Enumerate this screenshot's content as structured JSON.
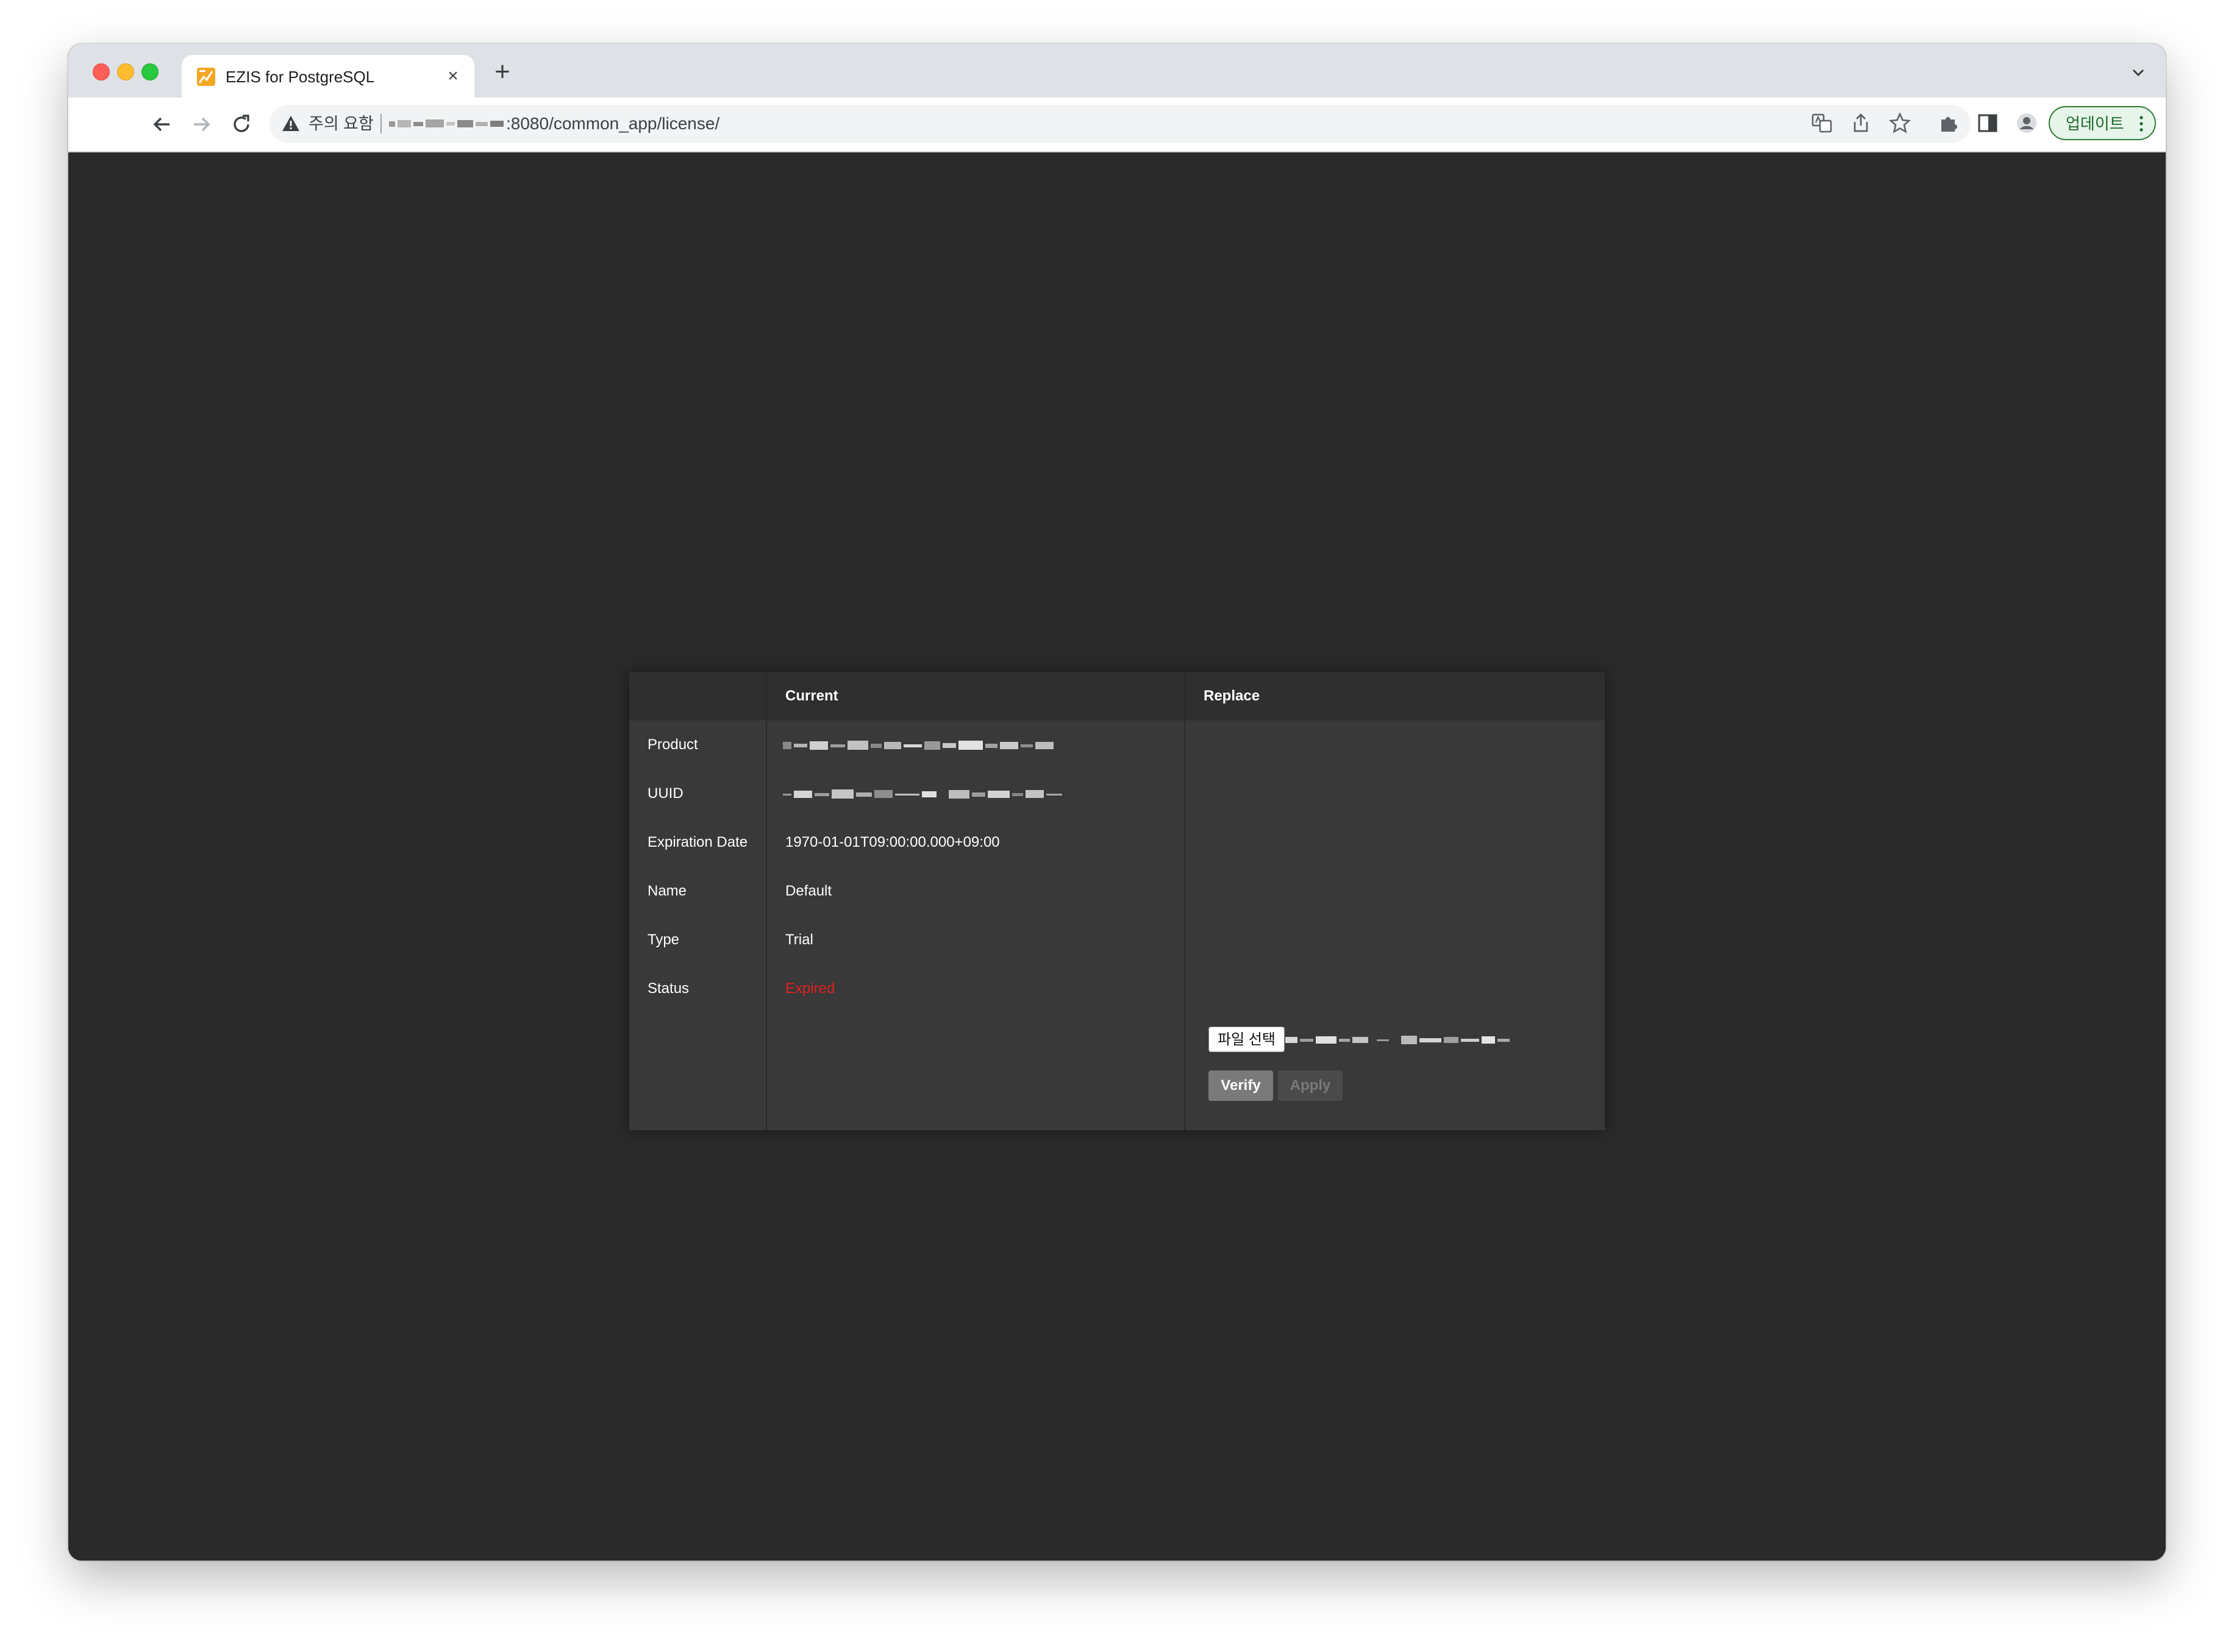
{
  "browser": {
    "tab": {
      "title": "EZIS for PostgreSQL",
      "close_glyph": "×",
      "favicon": "ezis-logo-icon"
    },
    "new_tab_glyph": "+",
    "address_bar": {
      "security_label": "주의 요함",
      "url_visible": ":8080/common_app/license/"
    },
    "update_button": {
      "label": "업데이트"
    }
  },
  "license": {
    "headers": {
      "current": "Current",
      "replace": "Replace"
    },
    "rows": [
      {
        "label": "Product",
        "value": null
      },
      {
        "label": "UUID",
        "value": null
      },
      {
        "label": "Expiration Date",
        "value": "1970-01-01T09:00:00.000+09:00"
      },
      {
        "label": "Name",
        "value": "Default"
      },
      {
        "label": "Type",
        "value": "Trial"
      },
      {
        "label": "Status",
        "value": "Expired"
      }
    ],
    "file_chooser_label": "파일 선택",
    "verify_label": "Verify",
    "apply_label": "Apply"
  },
  "colors": {
    "page_background": "#2a2a2a",
    "panel_background": "#393939",
    "header_background": "#2f2f2f",
    "status_expired": "#e02020",
    "update_button_border": "#2e7d32"
  }
}
